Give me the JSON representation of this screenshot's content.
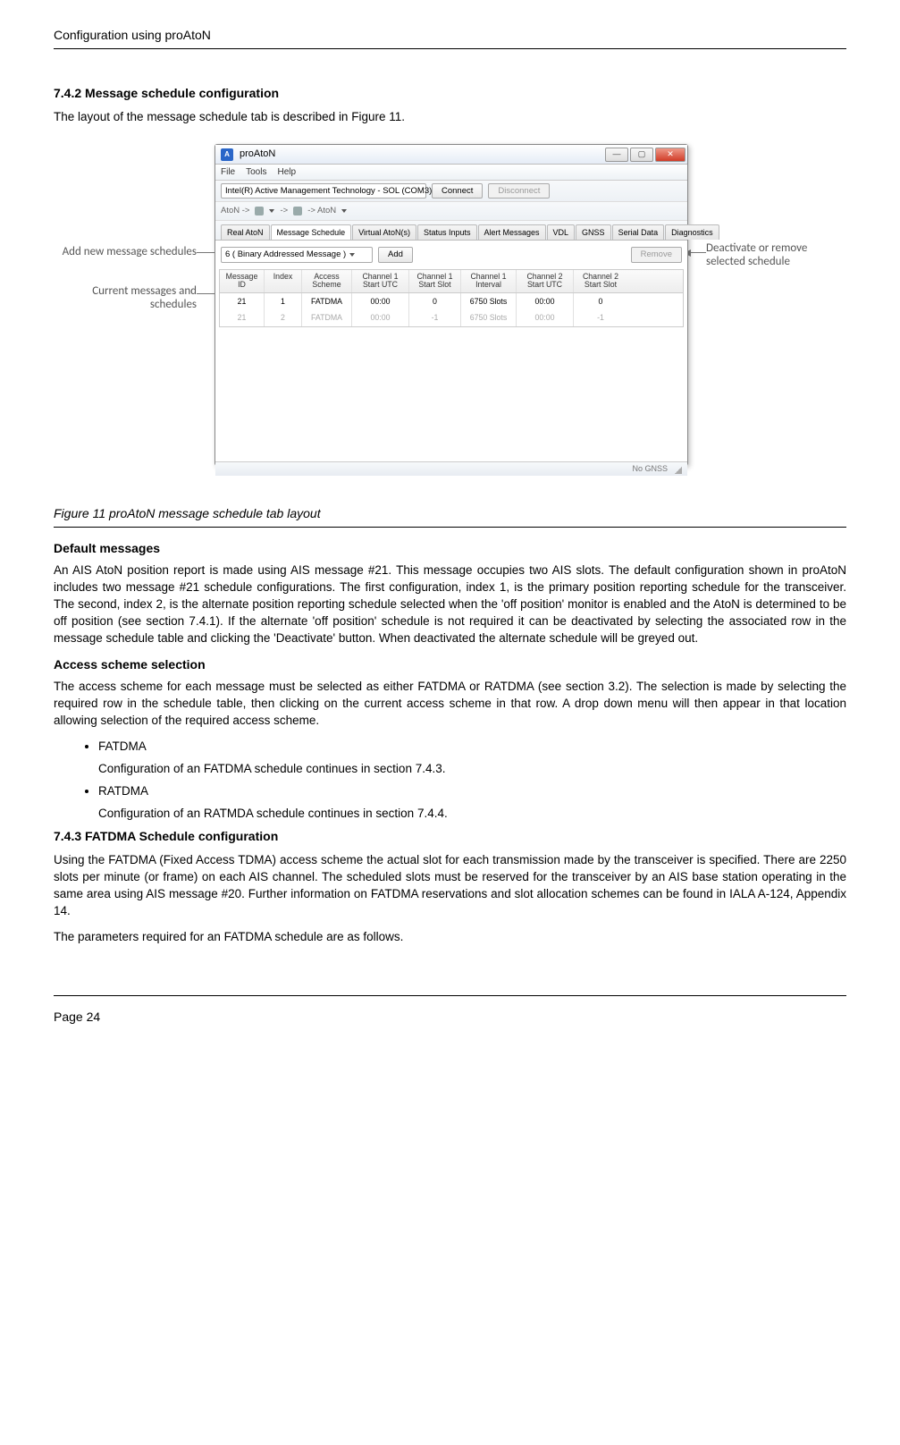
{
  "page": {
    "header": "Configuration using proAtoN",
    "footer": "Page 24"
  },
  "sections": {
    "s742_head": "7.4.2    Message schedule configuration",
    "s742_body": "The layout of the message schedule tab is described in Figure 11.",
    "fig_caption": "Figure 11   proAtoN message schedule tab layout",
    "default_head": "Default messages",
    "default_body": "An AIS AtoN position report is made using AIS message #21. This message occupies two AIS slots. The default configuration shown in proAtoN includes two message #21 schedule configurations. The first configuration, index 1, is the primary position reporting schedule for the transceiver. The second, index 2, is the alternate position reporting schedule selected when the 'off position' monitor is enabled and the AtoN is determined to be off position (see section 7.4.1). If the alternate 'off position' schedule is not required it can be deactivated by selecting the associated row in the message schedule table and clicking the 'Deactivate' button. When deactivated the alternate schedule will be greyed out.",
    "access_head": "Access scheme selection",
    "access_body": "The access scheme for each message must be selected as either FATDMA or RATDMA (see section 3.2). The selection is made by selecting the required row in the schedule table, then clicking on the current access scheme in that row. A drop down menu will then appear in that location allowing selection of the required access scheme.",
    "bullet1": "FATDMA",
    "bullet1_desc": "Configuration of an FATDMA schedule continues in section 7.4.3.",
    "bullet2": "RATDMA",
    "bullet2_desc": "Configuration of an RATMDA schedule continues in section 7.4.4.",
    "s743_head": "7.4.3    FATDMA Schedule configuration",
    "s743_p1": "Using the FATDMA (Fixed Access TDMA) access scheme the actual slot for each transmission made by the transceiver is specified.  There are 2250 slots per minute (or frame) on each AIS channel. The scheduled slots must be reserved for the transceiver by an AIS base station operating in the same area using AIS message #20. Further information on FATDMA reservations and slot allocation schemes can be found in IALA A-124, Appendix 14.",
    "s743_p2": "The parameters required for an FATDMA schedule are as follows."
  },
  "annotations": {
    "left1": "Add new message schedules",
    "left2": "Current messages and schedules",
    "right": "Deactivate or remove selected schedule"
  },
  "app": {
    "title": "proAtoN",
    "title_icon": "A",
    "menu": {
      "file": "File",
      "tools": "Tools",
      "help": "Help"
    },
    "conn": {
      "port": "Intel(R) Active Management Technology - SOL (COM3)",
      "connect": "Connect",
      "disconnect": "Disconnect"
    },
    "row2": {
      "left": "AtoN ->",
      "mid": "->",
      "right": "-> AtoN"
    },
    "tabs": [
      "Real AtoN",
      "Message Schedule",
      "Virtual AtoN(s)",
      "Status Inputs",
      "Alert Messages",
      "VDL",
      "GNSS",
      "Serial Data",
      "Diagnostics"
    ],
    "active_tab_idx": 1,
    "sched_combo": "6 ( Binary Addressed Message )",
    "add_btn": "Add",
    "remove_btn": "Remove",
    "table_headers": [
      "Message ID",
      "Index",
      "Access Scheme",
      "Channel 1 Start UTC",
      "Channel 1 Start Slot",
      "Channel 1 Interval",
      "Channel 2 Start UTC",
      "Channel 2 Start Slot"
    ],
    "rows": [
      {
        "cells": [
          "21",
          "1",
          "FATDMA",
          "00:00",
          "0",
          "6750 Slots",
          "00:00",
          "0"
        ],
        "grey": false
      },
      {
        "cells": [
          "21",
          "2",
          "FATDMA",
          "00:00",
          "-1",
          "6750 Slots",
          "00:00",
          "-1"
        ],
        "grey": true
      }
    ],
    "status": "No GNSS"
  }
}
